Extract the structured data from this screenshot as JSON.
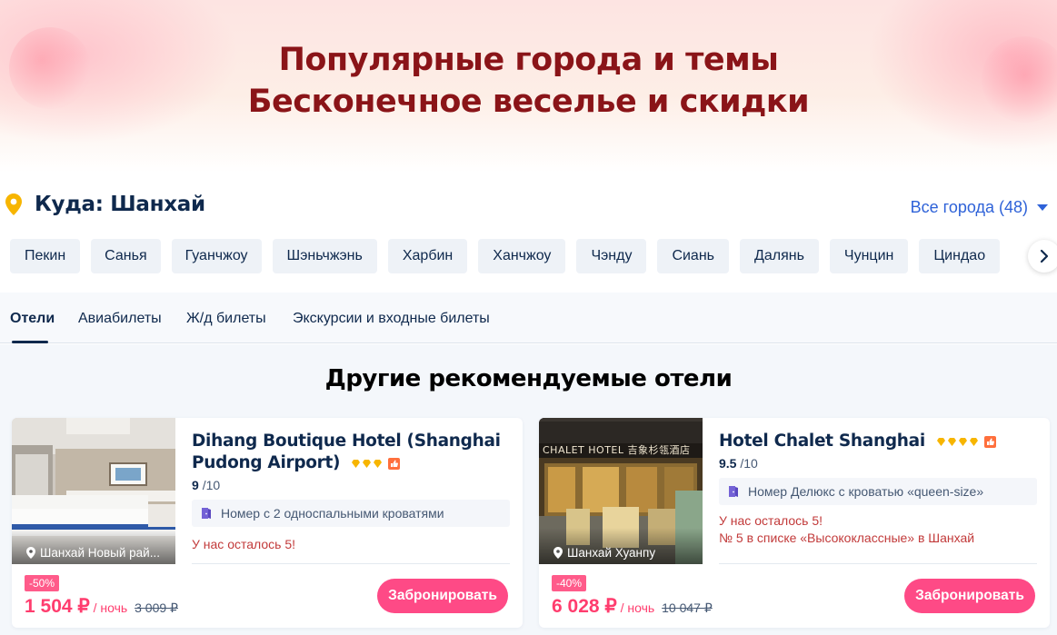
{
  "banner": {
    "line1": "Популярные города и темы",
    "line2": "Бесконечное веселье и скидки"
  },
  "destination": {
    "label": "Куда: Шанхай",
    "all_cities": "Все города (48)"
  },
  "cities": [
    "Пекин",
    "Санья",
    "Гуанчжоу",
    "Шэньчжэнь",
    "Харбин",
    "Ханчжоу",
    "Чэнду",
    "Сиань",
    "Далянь",
    "Чунцин",
    "Циндао"
  ],
  "tabs": [
    "Отели",
    "Авиабилеты",
    "Ж/д билеты",
    "Экскурсии и входные билеты"
  ],
  "section_title": "Другие рекомендуемые отели",
  "hotels": [
    {
      "name": "Dihang Boutique Hotel (Shanghai Pudong Airport)",
      "stars": 3,
      "score": "9",
      "score_max": "/10",
      "room": "Номер с 2 односпальными кроватями",
      "location": "Шанхай Новый рай...",
      "note1": "У нас осталось 5!",
      "note2": "",
      "discount": "-50%",
      "price": "1 504 ₽",
      "per_night": "/ ночь",
      "old_price": "3 009 ₽",
      "book": "Забронировать"
    },
    {
      "name": "Hotel Chalet Shanghai",
      "stars": 4,
      "score": "9.5",
      "score_max": "/10",
      "room": "Номер Делюкс с кроватью «queen-size»",
      "location": "Шанхай Хуанпу",
      "photo_sign": "CHALET HOTEL 吉象杉瓴酒店",
      "note1": "У нас осталось 5!",
      "note2": "№ 5 в списке «Высококлассные» в Шанхай",
      "discount": "-40%",
      "price": "6 028 ₽",
      "per_night": "/ ночь",
      "old_price": "10 047 ₽",
      "book": "Забронировать"
    }
  ],
  "colors": {
    "brand_pink": "#fe4a86",
    "link_blue": "#2e62d8",
    "banner_text": "#8a1418",
    "navy": "#0f294d",
    "pin_yellow": "#f7b500"
  }
}
